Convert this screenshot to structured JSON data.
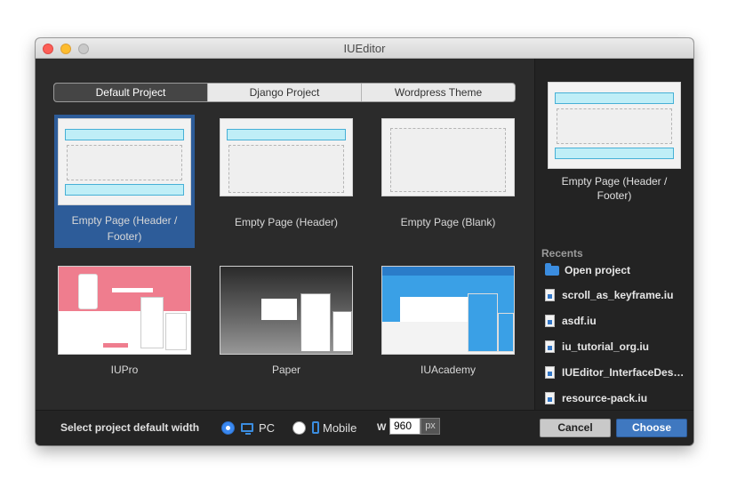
{
  "window": {
    "title": "IUEditor"
  },
  "tabs": [
    {
      "label": "Default Project",
      "active": true
    },
    {
      "label": "Django Project",
      "active": false
    },
    {
      "label": "Wordpress Theme",
      "active": false
    }
  ],
  "templates": [
    {
      "label": "Empty Page (Header / Footer)",
      "selected": true
    },
    {
      "label": "Empty Page (Header)",
      "selected": false
    },
    {
      "label": "Empty Page (Blank)",
      "selected": false
    },
    {
      "label": "IUPro",
      "selected": false
    },
    {
      "label": "Paper",
      "selected": false
    },
    {
      "label": "IUAcademy",
      "selected": false
    }
  ],
  "preview": {
    "label": "Empty Page (Header / Footer)"
  },
  "recents": {
    "title": "Recents",
    "open_project": "Open project",
    "files": [
      "scroll_as_keyframe.iu",
      "asdf.iu",
      "iu_tutorial_org.iu",
      "IUEditor_InterfaceDes…",
      "resource-pack.iu"
    ]
  },
  "bottom": {
    "width_label": "Select project default width",
    "option_pc": "PC",
    "option_mobile": "Mobile",
    "selected_option": "PC",
    "w_label": "W",
    "width_value": "960",
    "unit": "px",
    "cancel": "Cancel",
    "choose": "Choose"
  },
  "colors": {
    "selection": "#2d5c99",
    "primary_button": "#3f78c0",
    "accent_icon": "#3b8de0"
  }
}
